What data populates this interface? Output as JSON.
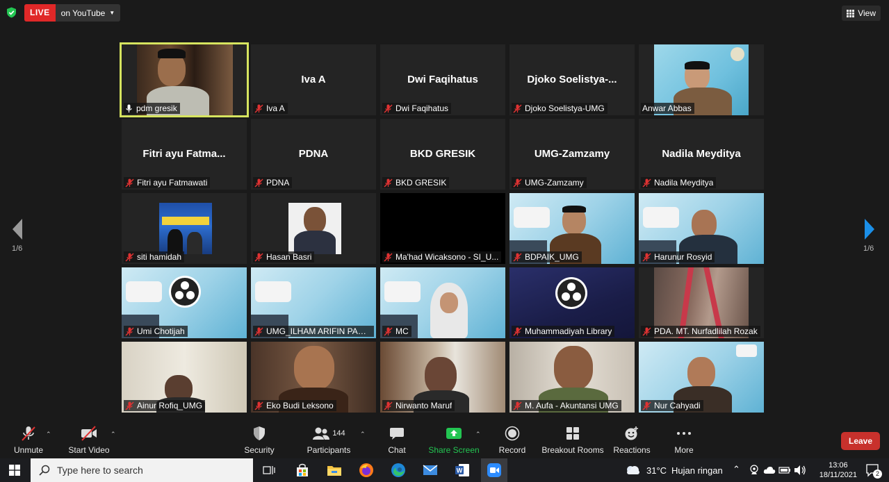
{
  "topbar": {
    "live_label": "LIVE",
    "live_destination": "on YouTube",
    "view_label": "View"
  },
  "gallery": {
    "tiles": [
      {
        "name": "pdm gresik",
        "display": "",
        "muted": false
      },
      {
        "name": "Iva A",
        "display": "Iva A",
        "muted": true
      },
      {
        "name": "Dwi Faqihatus",
        "display": "Dwi Faqihatus",
        "muted": true
      },
      {
        "name": "Djoko Soelistya-UMG",
        "display": "Djoko  Soelistya-...",
        "muted": true
      },
      {
        "name": "Anwar Abbas",
        "display": "",
        "muted": false
      },
      {
        "name": "Fitri ayu Fatmawati",
        "display": "Fitri ayu Fatma...",
        "muted": true
      },
      {
        "name": "PDNA",
        "display": "PDNA",
        "muted": true
      },
      {
        "name": "BKD GRESIK",
        "display": "BKD GRESIK",
        "muted": true
      },
      {
        "name": "UMG-Zamzamy",
        "display": "UMG-Zamzamy",
        "muted": true
      },
      {
        "name": "Nadila Meyditya",
        "display": "Nadila Meyditya",
        "muted": true
      },
      {
        "name": "siti hamidah",
        "display": "",
        "muted": true
      },
      {
        "name": "Hasan Basri",
        "display": "",
        "muted": true
      },
      {
        "name": "Ma'had Wicaksono - SI_U...",
        "display": "",
        "muted": true
      },
      {
        "name": "BDPAIK_UMG",
        "display": "",
        "muted": true
      },
      {
        "name": "Harunur Rosyid",
        "display": "",
        "muted": true
      },
      {
        "name": "Umi Chotijah",
        "display": "",
        "muted": true
      },
      {
        "name": "UMG_ILHAM ARIFIN PAHLA...",
        "display": "",
        "muted": true
      },
      {
        "name": "MC",
        "display": "",
        "muted": true
      },
      {
        "name": "Muhammadiyah Library",
        "display": "",
        "muted": true
      },
      {
        "name": "PDA. MT. Nurfadlilah Rozak",
        "display": "",
        "muted": true
      },
      {
        "name": "Ainur Rofiq_UMG",
        "display": "",
        "muted": true
      },
      {
        "name": "Eko Budi Leksono",
        "display": "",
        "muted": true
      },
      {
        "name": "Nirwanto Maruf",
        "display": "",
        "muted": true
      },
      {
        "name": "M. Aufa - Akuntansi UMG",
        "display": "",
        "muted": true
      },
      {
        "name": "Nur Cahyadi",
        "display": "",
        "muted": true
      }
    ]
  },
  "pagination": {
    "left": "1/6",
    "right": "1/6"
  },
  "toolbar": {
    "unmute": "Unmute",
    "start_video": "Start Video",
    "security": "Security",
    "participants": "Participants",
    "participant_count": "144",
    "chat": "Chat",
    "share_screen": "Share Screen",
    "record": "Record",
    "breakout_rooms": "Breakout Rooms",
    "reactions": "Reactions",
    "more": "More",
    "leave": "Leave"
  },
  "taskbar": {
    "search_placeholder": "Type here to search",
    "weather": "31°C",
    "weather_desc": "Hujan ringan",
    "time": "13:06",
    "date": "18/11/2021",
    "notification_count": "2"
  },
  "colors": {
    "active_speaker": "#d6e45f",
    "live_red": "#e02828",
    "share_green": "#23c552",
    "leave_red": "#c8312c",
    "nav_blue": "#1b8fe8"
  }
}
